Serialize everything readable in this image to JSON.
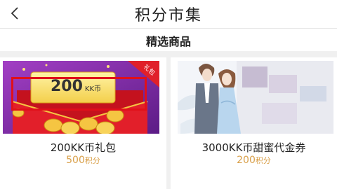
{
  "header": {
    "title": "积分市集"
  },
  "section": {
    "title": "精选商品"
  },
  "products": [
    {
      "name": "200KK币礼包",
      "price_value": "500",
      "price_unit": "积分",
      "banner_amount": "200",
      "banner_unit": "KK币",
      "corner_tag": "礼包"
    },
    {
      "name": "3000KK币甜蜜代金券",
      "price_value": "200",
      "price_unit": "积分"
    }
  ],
  "colors": {
    "price": "#d9a04a",
    "highlight": "#e0101a",
    "banner_bg": "#7a2a9c",
    "envelope": "#e21f2a",
    "gold": "#f5c542"
  }
}
